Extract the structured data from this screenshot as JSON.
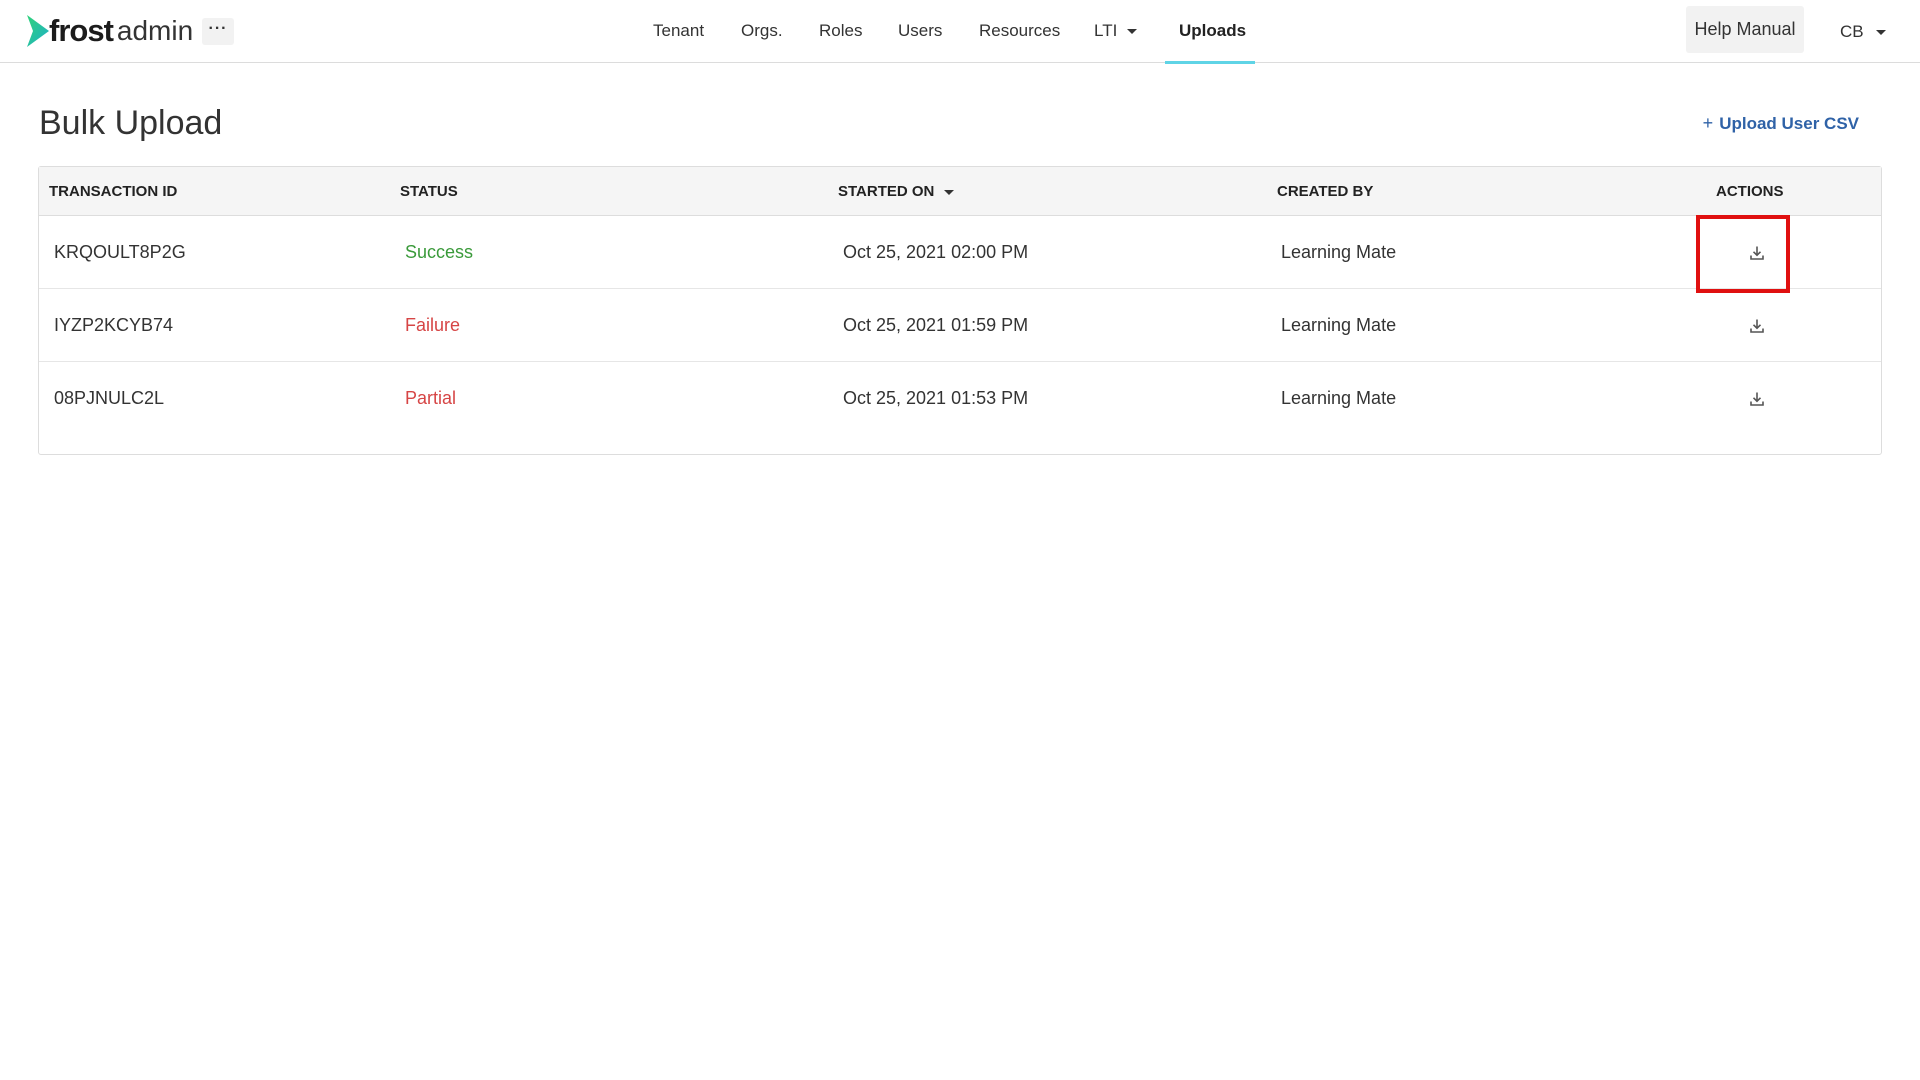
{
  "brand": {
    "frost": "frost",
    "admin": "admin",
    "more_label": "···"
  },
  "nav": {
    "items": [
      {
        "label": "Tenant"
      },
      {
        "label": "Orgs."
      },
      {
        "label": "Roles"
      },
      {
        "label": "Users"
      },
      {
        "label": "Resources"
      },
      {
        "label": "LTI"
      },
      {
        "label": "Uploads"
      }
    ],
    "active": "Uploads"
  },
  "header": {
    "help_label": "Help Manual",
    "user_initials": "CB"
  },
  "page": {
    "title": "Bulk Upload",
    "upload_plus": "+",
    "upload_label": "Upload User CSV"
  },
  "table": {
    "columns": [
      "TRANSACTION ID",
      "STATUS",
      "STARTED ON",
      "CREATED BY",
      "ACTIONS"
    ],
    "rows": [
      {
        "id": "KRQOULT8P2G",
        "status": "Success",
        "started_on": "Oct 25, 2021 02:00 PM",
        "created_by": "Learning Mate"
      },
      {
        "id": "IYZP2KCYB74",
        "status": "Failure",
        "started_on": "Oct 25, 2021 01:59 PM",
        "created_by": "Learning Mate"
      },
      {
        "id": "08PJNULC2L",
        "status": "Partial",
        "started_on": "Oct 25, 2021 01:53 PM",
        "created_by": "Learning Mate"
      }
    ]
  },
  "icons": {
    "download": "download-icon",
    "more": "more-horizontal-icon",
    "caret": "caret-down-icon",
    "logo": "chevron-logo-icon"
  },
  "colors": {
    "success": "#3a9a3a",
    "failure": "#d64545",
    "partial": "#d64545",
    "link": "#2f62a7",
    "active_underline": "#5fd4e6",
    "highlight": "#e01010"
  }
}
